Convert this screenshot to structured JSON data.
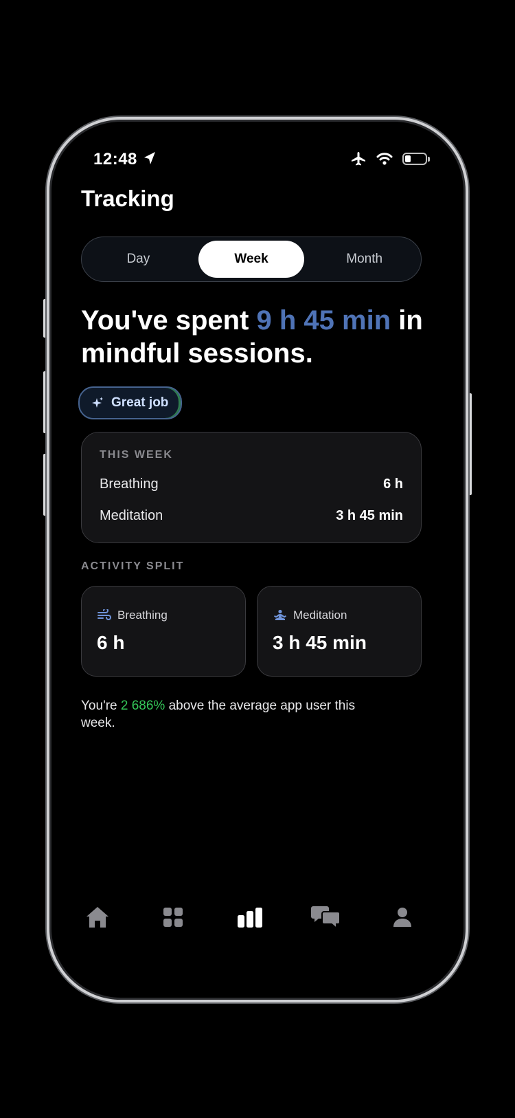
{
  "status": {
    "time": "12:48"
  },
  "header": {
    "title": "Tracking"
  },
  "segmented": {
    "day": "Day",
    "week": "Week",
    "month": "Month",
    "selected": "Week"
  },
  "summary": {
    "prefix": "You've spent ",
    "duration": "9 h 45 min",
    "suffix": " in mindful sessions."
  },
  "badge": {
    "label": "Great job"
  },
  "this_week": {
    "label": "THIS WEEK",
    "rows": [
      {
        "name": "Breathing",
        "value": "6 h"
      },
      {
        "name": "Meditation",
        "value": "3 h 45 min"
      }
    ]
  },
  "activity_split": {
    "label": "ACTIVITY SPLIT",
    "cards": [
      {
        "name": "Breathing",
        "value": "6 h",
        "icon": "wind-icon"
      },
      {
        "name": "Meditation",
        "value": "3 h 45 min",
        "icon": "meditation-icon"
      }
    ]
  },
  "comparison": {
    "prefix": "You're ",
    "percent": "2 686%",
    "suffix": " above the average app user this week."
  },
  "tabbar": {
    "items": [
      {
        "icon": "home-icon",
        "active": false
      },
      {
        "icon": "grid-icon",
        "active": false
      },
      {
        "icon": "bar-chart-icon",
        "active": true
      },
      {
        "icon": "chat-icon",
        "active": false
      },
      {
        "icon": "profile-icon",
        "active": false
      }
    ]
  },
  "colors": {
    "accent": "#4f73b6",
    "positive": "#34c759",
    "background": "#000000"
  }
}
